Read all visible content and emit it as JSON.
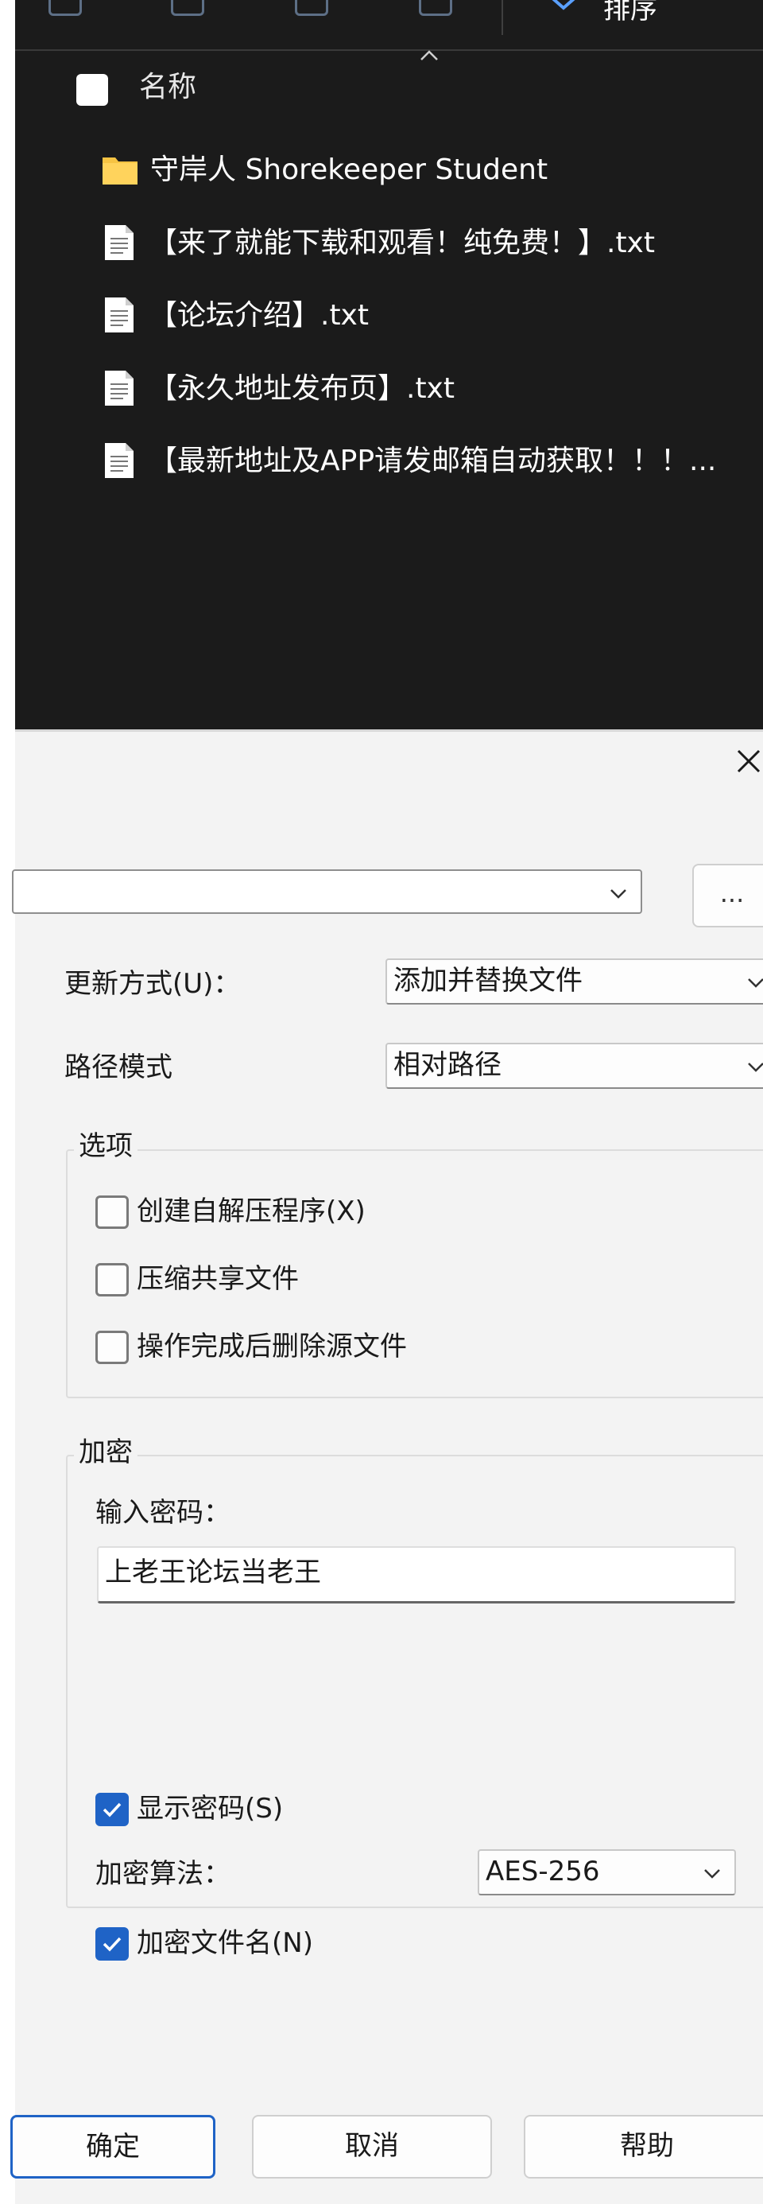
{
  "explorer": {
    "sort_label": "排序",
    "header": {
      "name_column": "名称"
    },
    "items": [
      {
        "type": "folder",
        "name": "守岸人 Shorekeeper Student"
      },
      {
        "type": "txt",
        "name": "【来了就能下载和观看！纯免费！】.txt"
      },
      {
        "type": "txt",
        "name": "【论坛介绍】.txt"
      },
      {
        "type": "txt",
        "name": "【永久地址发布页】.txt"
      },
      {
        "type": "txt",
        "name": "【最新地址及APP请发邮箱自动获取！！！..."
      }
    ]
  },
  "dialog": {
    "browse_label": "...",
    "update_mode": {
      "label": "更新方式(U)：",
      "value": "添加并替换文件"
    },
    "path_mode": {
      "label": "路径模式",
      "value": "相对路径"
    },
    "options": {
      "title": "选项",
      "items": [
        {
          "label": "创建自解压程序(X)",
          "checked": false
        },
        {
          "label": "压缩共享文件",
          "checked": false
        },
        {
          "label": "操作完成后删除源文件",
          "checked": false
        }
      ]
    },
    "encryption": {
      "title": "加密",
      "password_label": "输入密码：",
      "password_value": "上老王论坛当老王",
      "show_password": {
        "label": "显示密码(S)",
        "checked": true
      },
      "algorithm": {
        "label": "加密算法：",
        "value": "AES-256"
      },
      "encrypt_filenames": {
        "label": "加密文件名(N)",
        "checked": true
      }
    },
    "buttons": {
      "ok": "确定",
      "cancel": "取消",
      "help": "帮助"
    }
  },
  "colors": {
    "explorer_bg": "#1b1b1b",
    "dialog_bg": "#f3f3f3",
    "accent": "#1f63c6",
    "folder": "#f6c343"
  }
}
